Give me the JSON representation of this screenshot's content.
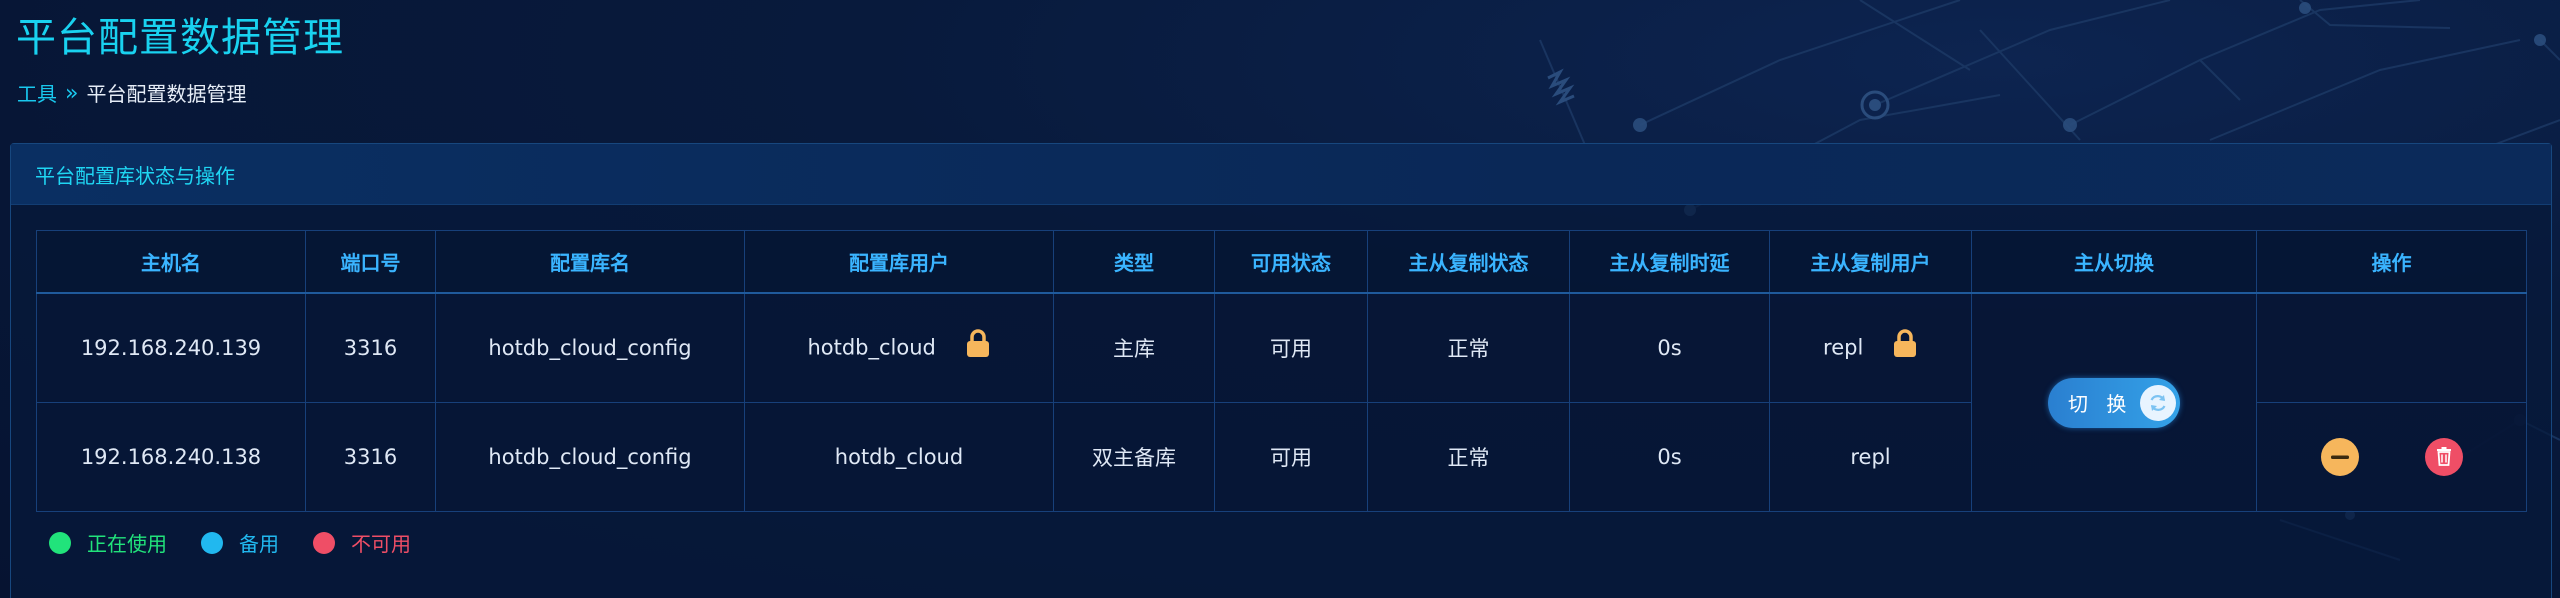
{
  "page": {
    "title": "平台配置数据管理"
  },
  "breadcrumb": {
    "parent": "工具",
    "separator": "»",
    "current": "平台配置数据管理"
  },
  "panel": {
    "title": "平台配置库状态与操作"
  },
  "table": {
    "headers": [
      "主机名",
      "端口号",
      "配置库名",
      "配置库用户",
      "类型",
      "可用状态",
      "主从复制状态",
      "主从复制时延",
      "主从复制用户",
      "主从切换",
      "操作"
    ],
    "rows": [
      {
        "host": "192.168.240.139",
        "port": "3316",
        "db_name": "hotdb_cloud_config",
        "db_user": "hotdb_cloud",
        "db_user_icon": "lock-icon",
        "type": "主库",
        "availability": "可用",
        "availability_color": "#21e37b",
        "replication_status": "正常",
        "replication_delay": "0s",
        "replication_user": "repl",
        "replication_user_icon": "lock-icon"
      },
      {
        "host": "192.168.240.138",
        "port": "3316",
        "db_name": "hotdb_cloud_config",
        "db_user": "hotdb_cloud",
        "type": "双主备库",
        "availability": "可用",
        "availability_color": "#21b8ef",
        "replication_status": "正常",
        "replication_delay": "0s",
        "replication_user": "repl",
        "actions": [
          "minus-icon",
          "trash-icon"
        ]
      }
    ],
    "switch_label": "切 换",
    "switch_icon": "refresh-icon"
  },
  "legend": [
    {
      "label": "正在使用",
      "color": "#21e37b"
    },
    {
      "label": "备用",
      "color": "#21b8ef"
    },
    {
      "label": "不可用",
      "color": "#ef4e66"
    }
  ],
  "colors": {
    "accent": "#19d2f0",
    "header_text": "#3ab4ff",
    "lock": "#f6b65c",
    "delete": "#ef4e66"
  }
}
